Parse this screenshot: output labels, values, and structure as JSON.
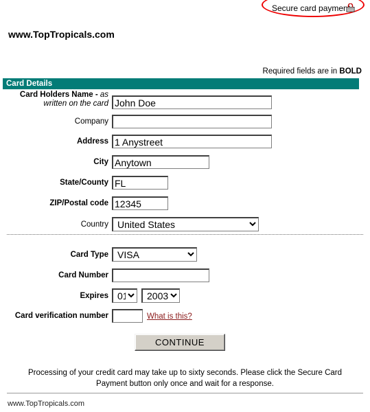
{
  "annotation": {
    "secure_label": "Secure card payment",
    "lock_icon": "lock-icon",
    "circle_color": "#ee0000"
  },
  "site": {
    "title": "www.TopTropicals.com",
    "footer": "www.TopTropicals.com"
  },
  "notice": {
    "required_prefix": "Required fields are in ",
    "required_bold": "BOLD"
  },
  "section": {
    "header": "Card Details",
    "header_color": "#037c77"
  },
  "fields": {
    "card_holder_name": {
      "label_bold": "Card Holders Name - ",
      "label_italic_1": "as",
      "label_italic_2": "written on the card",
      "value": "John Doe"
    },
    "company": {
      "label": "Company",
      "value": ""
    },
    "address": {
      "label": "Address",
      "value": "1 Anystreet"
    },
    "city": {
      "label": "City",
      "value": "Anytown"
    },
    "state_county": {
      "label": "State/County",
      "value": "FL"
    },
    "zip_postal": {
      "label": "ZIP/Postal code",
      "value": "12345"
    },
    "country": {
      "label": "Country",
      "value": "United States",
      "options": [
        "United States"
      ]
    },
    "card_type": {
      "label": "Card Type",
      "value": "VISA",
      "options": [
        "VISA"
      ]
    },
    "card_number": {
      "label": "Card Number",
      "value": ""
    },
    "expires": {
      "label": "Expires",
      "month_value": "01",
      "month_options": [
        "01"
      ],
      "year_value": "2003",
      "year_options": [
        "2003"
      ]
    },
    "card_verification": {
      "label": "Card verification number",
      "value": "",
      "help_link": "What is this?",
      "help_link_color": "#8b1a1a"
    }
  },
  "actions": {
    "continue_label": "CONTINUE"
  },
  "processing_note": "Processing of your credit card may take up to sixty seconds. Please click the Secure Card Payment button only once and wait for a response."
}
